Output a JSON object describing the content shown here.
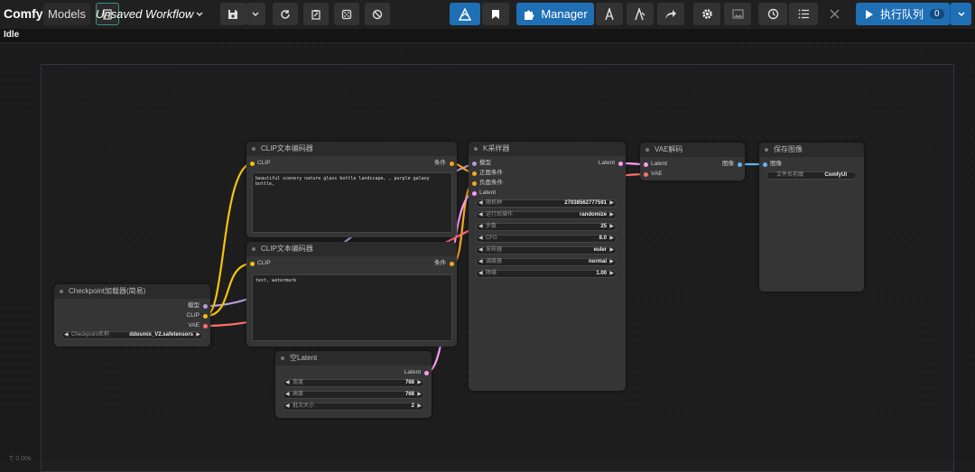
{
  "app": {
    "logo_text": "ComfyUI",
    "models_label": "Models",
    "workflow_name": "Unsaved Workflow"
  },
  "toolbar": {
    "manager_label": "Manager",
    "run_label": "执行队列",
    "queue_count": "0"
  },
  "status": {
    "idle": "Idle",
    "timer": "T: 0.00s"
  },
  "nodes": {
    "clip1": {
      "title": "CLIP文本编码器",
      "in_clip": "CLIP",
      "out": "条件",
      "text": "beautiful scenery nature glass bottle landscape, , purple galaxy bottle,"
    },
    "clip2": {
      "title": "CLIP文本编码器",
      "in_clip": "CLIP",
      "out": "条件",
      "text": "text, watermark"
    },
    "ksampler": {
      "title": "K采样器",
      "in_model": "模型",
      "in_pos": "正面条件",
      "in_neg": "负面条件",
      "in_latent": "Latent",
      "out": "Latent",
      "widgets": [
        {
          "label": "随机种",
          "value": "270385627775​91"
        },
        {
          "label": "运行后操作",
          "value": "randomize"
        },
        {
          "label": "步数",
          "value": "25"
        },
        {
          "label": "CFG",
          "value": "8.0"
        },
        {
          "label": "采样器",
          "value": "euler"
        },
        {
          "label": "调度器",
          "value": "normal"
        },
        {
          "label": "降噪",
          "value": "1.00"
        }
      ]
    },
    "vae": {
      "title": "VAE解码",
      "in_latent": "Latent",
      "in_vae": "VAE",
      "out": "图像"
    },
    "save": {
      "title": "保存图像",
      "in_image": "图像",
      "widget_label": "文件名前缀",
      "widget_value": "ComfyUI"
    },
    "checkpoint": {
      "title": "Checkpoint加载器(简易)",
      "out_model": "模型",
      "out_clip": "CLIP",
      "out_vae": "VAE",
      "widget_label": "Checkpoint名称",
      "widget_value": "ddosmix_V2.safetensors"
    },
    "latent": {
      "title": "空Latent",
      "out": "Latent",
      "widgets": [
        {
          "label": "宽度",
          "value": "768"
        },
        {
          "label": "高度",
          "value": "768"
        },
        {
          "label": "批次大小",
          "value": "2"
        }
      ]
    }
  },
  "colors": {
    "clip": "#f4c20d",
    "cond": "#f5a623",
    "model": "#b39ddb",
    "latent": "#ff9cf9",
    "vae": "#ff6e6e",
    "image": "#64b5f6",
    "accent": "#1f6fb5"
  }
}
